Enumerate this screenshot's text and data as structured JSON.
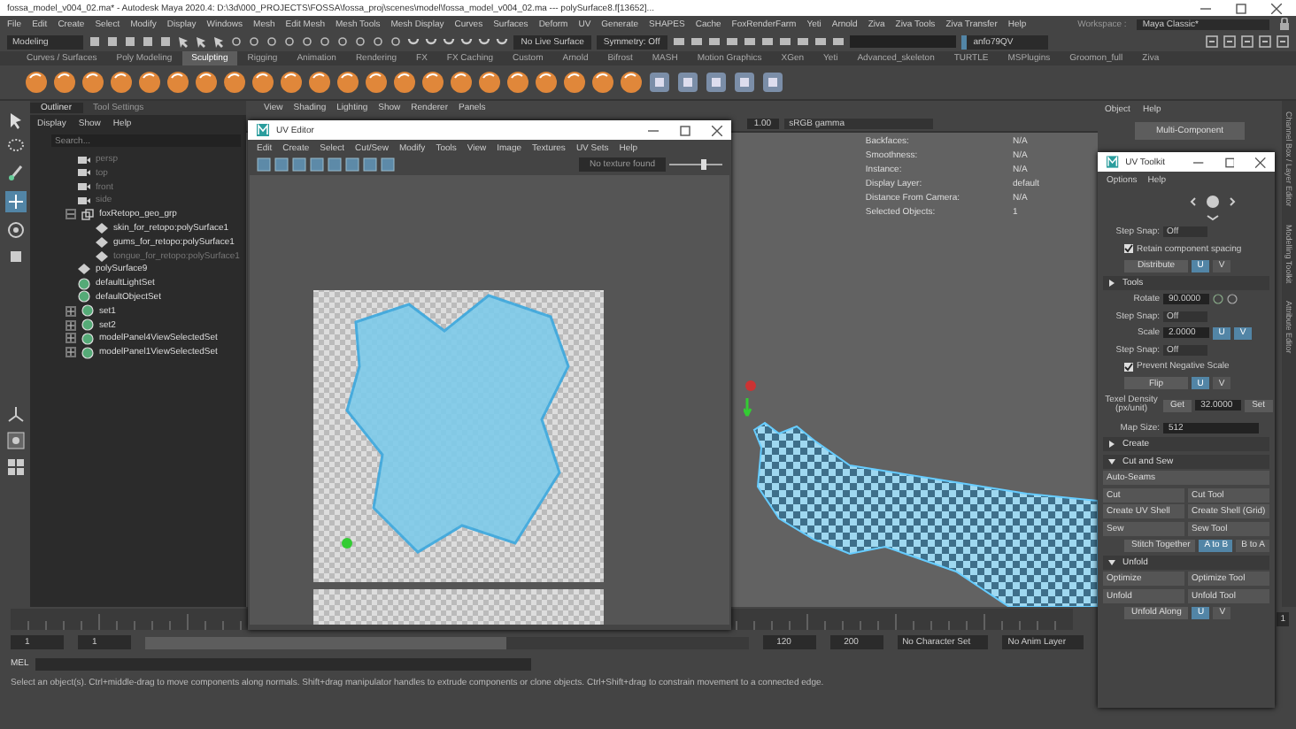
{
  "window": {
    "title": "fossa_model_v004_02.ma* - Autodesk Maya 2020.4: D:\\3d\\000_PROJECTS\\FOSSA\\fossa_proj\\scenes\\model\\fossa_model_v004_02.ma --- polySurface8.f[13652]..."
  },
  "menu": [
    "File",
    "Edit",
    "Create",
    "Select",
    "Modify",
    "Display",
    "Windows",
    "Mesh",
    "Edit Mesh",
    "Mesh Tools",
    "Mesh Display",
    "Curves",
    "Surfaces",
    "Deform",
    "UV",
    "Generate",
    "SHAPES",
    "Cache",
    "FoxRenderFarm",
    "Yeti",
    "Arnold",
    "Ziva",
    "Ziva Tools",
    "Ziva Transfer",
    "Help"
  ],
  "workspace": {
    "label": "Workspace :",
    "value": "Maya Classic*"
  },
  "status_line": {
    "mode": "Modeling",
    "live_surface": "No Live Surface",
    "symmetry": "Symmetry: Off",
    "user": "anfo79QV"
  },
  "shelf_tabs": [
    {
      "label": "Curves / Surfaces",
      "selected": false
    },
    {
      "label": "Poly Modeling",
      "selected": false
    },
    {
      "label": "Sculpting",
      "selected": true
    },
    {
      "label": "Rigging",
      "selected": false
    },
    {
      "label": "Animation",
      "selected": false
    },
    {
      "label": "Rendering",
      "selected": false
    },
    {
      "label": "FX",
      "selected": false
    },
    {
      "label": "FX Caching",
      "selected": false
    },
    {
      "label": "Custom",
      "selected": false
    },
    {
      "label": "Arnold",
      "selected": false
    },
    {
      "label": "Bifrost",
      "selected": false
    },
    {
      "label": "MASH",
      "selected": false
    },
    {
      "label": "Motion Graphics",
      "selected": false
    },
    {
      "label": "XGen",
      "selected": false
    },
    {
      "label": "Yeti",
      "selected": false
    },
    {
      "label": "Advanced_skeleton",
      "selected": false
    },
    {
      "label": "TURTLE",
      "selected": false
    },
    {
      "label": "MSPlugins",
      "selected": false
    },
    {
      "label": "Groomon_full",
      "selected": false
    },
    {
      "label": "Ziva",
      "selected": false
    }
  ],
  "outliner": {
    "tabs": [
      {
        "label": "Outliner",
        "selected": true
      },
      {
        "label": "Tool Settings",
        "selected": false
      }
    ],
    "menu": [
      "Display",
      "Show",
      "Help"
    ],
    "search": {
      "placeholder": "Search..."
    },
    "items": [
      {
        "label": "persp",
        "kind": "camera",
        "hidden": true
      },
      {
        "label": "top",
        "kind": "camera",
        "hidden": true
      },
      {
        "label": "front",
        "kind": "camera",
        "hidden": true
      },
      {
        "label": "side",
        "kind": "camera",
        "hidden": true
      },
      {
        "label": "foxRetopo_geo_grp",
        "kind": "group",
        "hidden": false,
        "expanded": true,
        "children": [
          {
            "label": "skin_for_retopo:polySurface1",
            "kind": "mesh",
            "hidden": false
          },
          {
            "label": "gums_for_retopo:polySurface1",
            "kind": "mesh",
            "hidden": false
          },
          {
            "label": "tongue_for_retopo:polySurface1",
            "kind": "mesh",
            "hidden": true
          }
        ]
      },
      {
        "label": "polySurface9",
        "kind": "mesh",
        "hidden": false
      },
      {
        "label": "defaultLightSet",
        "kind": "set",
        "hidden": false
      },
      {
        "label": "defaultObjectSet",
        "kind": "set",
        "hidden": false
      },
      {
        "label": "set1",
        "kind": "set",
        "hidden": false,
        "expanded": false
      },
      {
        "label": "set2",
        "kind": "set",
        "hidden": false,
        "expanded": false
      },
      {
        "label": "modelPanel4ViewSelectedSet",
        "kind": "set",
        "hidden": false,
        "expanded": false
      },
      {
        "label": "modelPanel1ViewSelectedSet",
        "kind": "set",
        "hidden": false,
        "expanded": false
      }
    ]
  },
  "viewport": {
    "menu": [
      "View",
      "Shading",
      "Lighting",
      "Show",
      "Renderer",
      "Panels"
    ],
    "gamma": "1.00",
    "color_space": "sRGB gamma",
    "hud": [
      {
        "label": "Backfaces:",
        "value": "N/A"
      },
      {
        "label": "Smoothness:",
        "value": "N/A"
      },
      {
        "label": "Instance:",
        "value": "N/A"
      },
      {
        "label": "Display Layer:",
        "value": "default"
      },
      {
        "label": "Distance From Camera:",
        "value": "N/A"
      },
      {
        "label": "Selected Objects:",
        "value": "1"
      }
    ]
  },
  "side_panel": {
    "menu": [
      "Object",
      "Help"
    ],
    "button": "Multi-Component",
    "tabs": [
      "Channel Box / Layer Editor",
      "Modelling Toolkit",
      "Attribute Editor"
    ]
  },
  "uv_editor": {
    "title": "UV Editor",
    "menu": [
      "Edit",
      "Create",
      "Select",
      "Cut/Sew",
      "Modify",
      "Tools",
      "View",
      "Image",
      "Textures",
      "UV Sets",
      "Help"
    ],
    "texture_status": "No texture found"
  },
  "uv_toolkit": {
    "title": "UV Toolkit",
    "menu": [
      "Options",
      "Help"
    ],
    "rows": [
      {
        "kind": "step_snap",
        "label": "Step Snap:",
        "value": "Off"
      },
      {
        "kind": "checkbox",
        "label": "Retain component spacing",
        "checked": true
      },
      {
        "kind": "toggle",
        "label": "Distribute",
        "options": [
          {
            "label": "U",
            "selected": true
          },
          {
            "label": "V",
            "selected": false
          }
        ]
      },
      {
        "kind": "section",
        "label": "Tools",
        "expanded": false
      },
      {
        "kind": "number",
        "label": "Rotate",
        "value": "90.0000"
      },
      {
        "kind": "step_snap",
        "label": "Step Snap:",
        "value": "Off"
      },
      {
        "kind": "number",
        "label": "Scale",
        "value": "2.0000",
        "options": [
          {
            "label": "U",
            "selected": true
          },
          {
            "label": "V",
            "selected": true
          }
        ]
      },
      {
        "kind": "step_snap",
        "label": "Step Snap:",
        "value": "Off"
      },
      {
        "kind": "checkbox",
        "label": "Prevent Negative Scale",
        "checked": true
      },
      {
        "kind": "toggle",
        "label": "Flip",
        "options": [
          {
            "label": "U",
            "selected": true
          },
          {
            "label": "V",
            "selected": false
          }
        ]
      },
      {
        "kind": "texel",
        "label": "Texel Density (px/unit)",
        "get": "Get",
        "value": "32.0000",
        "set": "Set"
      },
      {
        "kind": "field",
        "label": "Map Size:",
        "value": "512"
      },
      {
        "kind": "section",
        "label": "Create",
        "expanded": false
      },
      {
        "kind": "section",
        "label": "Cut and Sew",
        "expanded": true
      },
      {
        "kind": "actions",
        "items": [
          "Auto-Seams"
        ]
      },
      {
        "kind": "actions",
        "items": [
          "Cut",
          "Cut Tool"
        ]
      },
      {
        "kind": "actions",
        "items": [
          "Create UV Shell",
          "Create Shell (Grid)"
        ]
      },
      {
        "kind": "actions",
        "items": [
          "Sew",
          "Sew Tool"
        ]
      },
      {
        "kind": "toggle",
        "label": "Stitch Together",
        "options": [
          {
            "label": "A to B",
            "selected": true
          },
          {
            "label": "B to A",
            "selected": false
          }
        ]
      },
      {
        "kind": "section",
        "label": "Unfold",
        "expanded": true
      },
      {
        "kind": "actions",
        "items": [
          "Optimize",
          "Optimize Tool"
        ]
      },
      {
        "kind": "actions",
        "items": [
          "Unfold",
          "Unfold Tool"
        ]
      },
      {
        "kind": "toggle",
        "label": "Unfold Along",
        "options": [
          {
            "label": "U",
            "selected": true
          },
          {
            "label": "V",
            "selected": false
          }
        ]
      }
    ]
  },
  "range": {
    "level": 0.6,
    "start": "1",
    "inner_start": "1",
    "inner_end": "120",
    "end": "200",
    "character_set": "No Character Set",
    "anim_layer": "No Anim Layer"
  },
  "timeline": {
    "current_frame": "1"
  },
  "command_line": {
    "language": "MEL"
  },
  "help_line": "Select an object(s). Ctrl+middle-drag to move components along normals. Shift+drag manipulator handles to extrude components or clone objects. Ctrl+Shift+drag to constrain movement to a connected edge."
}
